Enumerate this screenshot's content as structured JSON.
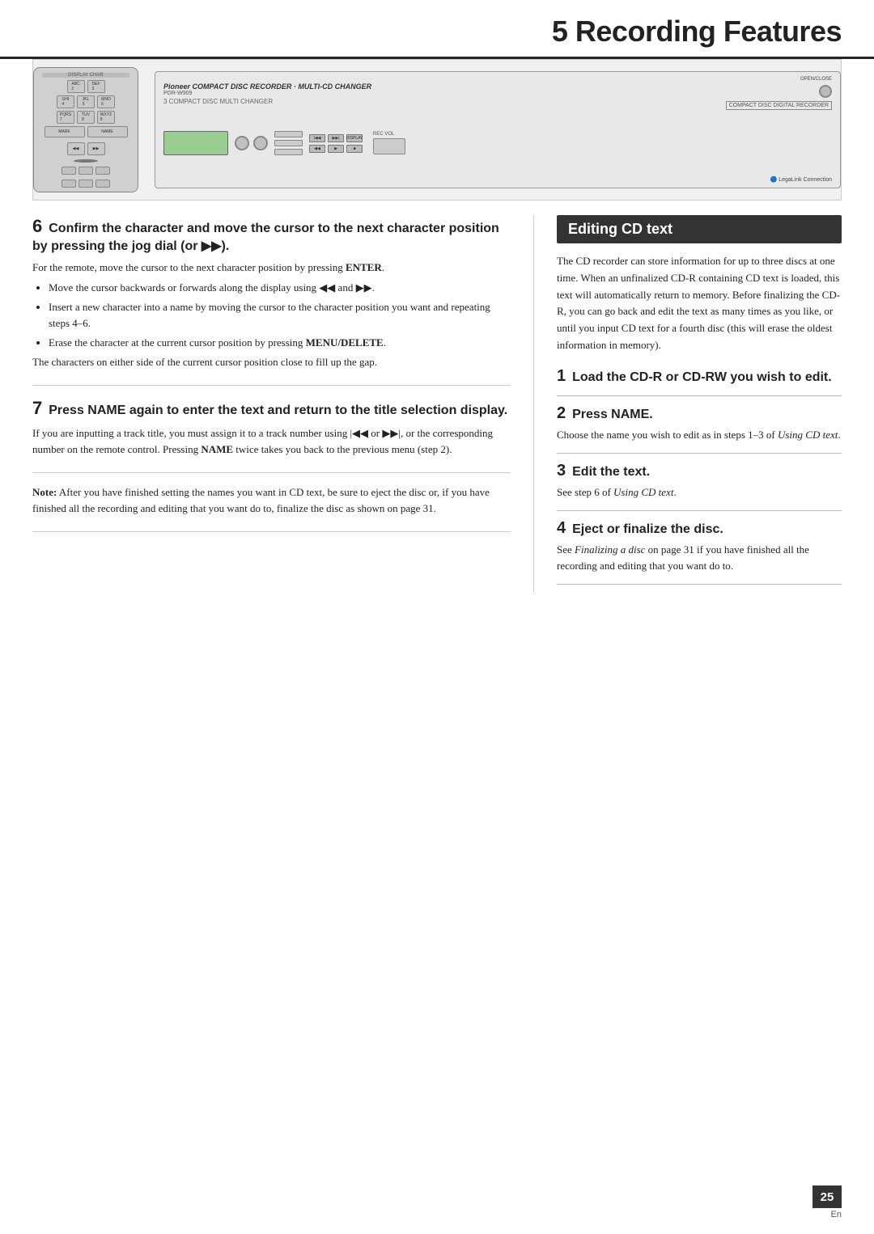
{
  "page": {
    "title": "Recording Features",
    "title_prefix": "5 ",
    "page_number": "25",
    "page_label": "En"
  },
  "device_image": {
    "alt": "Pioneer PDR-W909 CD recorder and remote control"
  },
  "left_column": {
    "step6": {
      "number": "6",
      "heading": "Confirm the character and move the cursor to the next character position by pressing the jog dial (or ▶▶).",
      "body_intro": "For the remote, move the cursor to the next character position by pressing ENTER.",
      "bullets": [
        "Move the cursor backwards or forwards along the display using ◀◀ and ▶▶.",
        "Insert a new character into a name by moving the cursor to the character position you want and repeating steps 4–6.",
        "Erase the character at the current cursor position by pressing MENU/DELETE."
      ],
      "body_note": "The characters on either side of the current cursor position close to fill up the gap."
    },
    "step7": {
      "number": "7",
      "heading": "Press NAME again to enter the text and return to the title selection display.",
      "body": "If you are inputting a track title, you must assign it to a track number using |◀◀ or ▶▶|, or the corresponding number on the remote control. Pressing NAME twice takes you back to the previous menu (step 2)."
    },
    "note": {
      "label": "Note:",
      "text": "After you have finished setting the names you want in CD text, be sure to eject the disc or, if you have finished all the recording and editing that you want do to, finalize the disc as shown on page 31."
    }
  },
  "right_column": {
    "section_title": "Editing CD text",
    "intro": "The CD recorder can store information for up to three discs at one time. When an unfinalized CD-R containing CD text is loaded, this text will automatically return to memory. Before finalizing the CD-R, you can go back and edit the text as many times as you like, or until you input CD text for a fourth disc (this will erase the oldest information in memory).",
    "steps": [
      {
        "number": "1",
        "heading": "Load the CD-R or CD-RW you wish to edit."
      },
      {
        "number": "2",
        "heading": "Press NAME.",
        "body": "Choose the name you wish to edit as in steps 1–3 of Using CD text."
      },
      {
        "number": "3",
        "heading": "Edit the text.",
        "body": "See step 6 of Using CD text."
      },
      {
        "number": "4",
        "heading": "Eject or finalize the disc.",
        "body": "See Finalizing a disc on page 31 if you have finished all the recording and editing that you want do to."
      }
    ]
  }
}
